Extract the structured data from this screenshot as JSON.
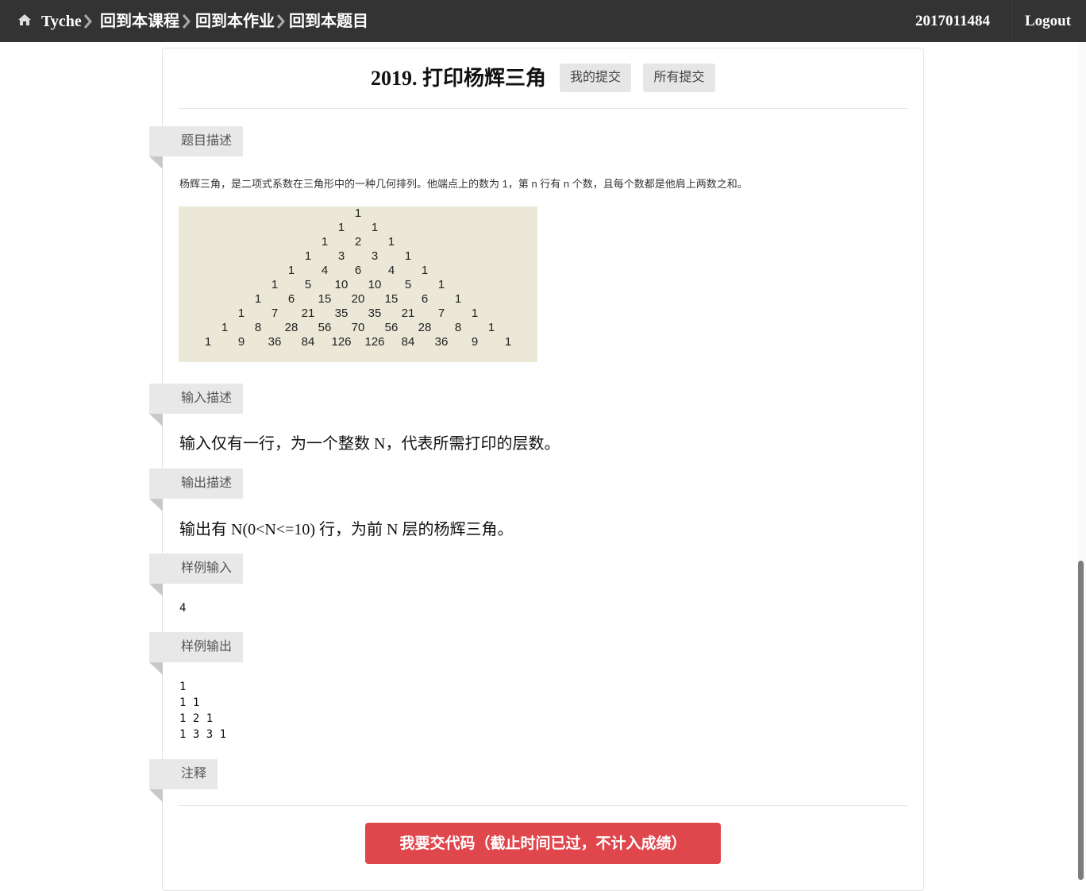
{
  "nav": {
    "home_label": "Tyche",
    "breadcrumbs": [
      "回到本课程",
      "回到本作业",
      "回到本题目"
    ],
    "user": "2017011484",
    "logout": "Logout"
  },
  "problem": {
    "title": "2019. 打印杨辉三角",
    "my_submissions": "我的提交",
    "all_submissions": "所有提交"
  },
  "sections": {
    "description": {
      "label": "题目描述",
      "text": "杨辉三角，是二项式系数在三角形中的一种几何排列。他端点上的数为 1，第 n 行有 n 个数，且每个数都是他肩上两数之和。"
    },
    "input": {
      "label": "输入描述",
      "text": "输入仅有一行，为一个整数 N，代表所需打印的层数。"
    },
    "output": {
      "label": "输出描述",
      "text": "输出有 N(0<N<=10) 行，为前 N 层的杨辉三角。"
    },
    "sample_input": {
      "label": "样例输入",
      "text": "4"
    },
    "sample_output": {
      "label": "样例输出",
      "text": "1\n1 1\n1 2 1\n1 3 3 1"
    },
    "notes": {
      "label": "注释"
    }
  },
  "pascal_triangle": [
    [
      1
    ],
    [
      1,
      1
    ],
    [
      1,
      2,
      1
    ],
    [
      1,
      3,
      3,
      1
    ],
    [
      1,
      4,
      6,
      4,
      1
    ],
    [
      1,
      5,
      10,
      10,
      5,
      1
    ],
    [
      1,
      6,
      15,
      20,
      15,
      6,
      1
    ],
    [
      1,
      7,
      21,
      35,
      35,
      21,
      7,
      1
    ],
    [
      1,
      8,
      28,
      56,
      70,
      56,
      28,
      8,
      1
    ],
    [
      1,
      9,
      36,
      84,
      126,
      126,
      84,
      36,
      9,
      1
    ]
  ],
  "submit": {
    "label": "我要交代码（截止时间已过，不计入成绩）",
    "color": "#e0474c"
  },
  "icons": {
    "home": "home-icon",
    "separator": "chevron-right-icon"
  }
}
